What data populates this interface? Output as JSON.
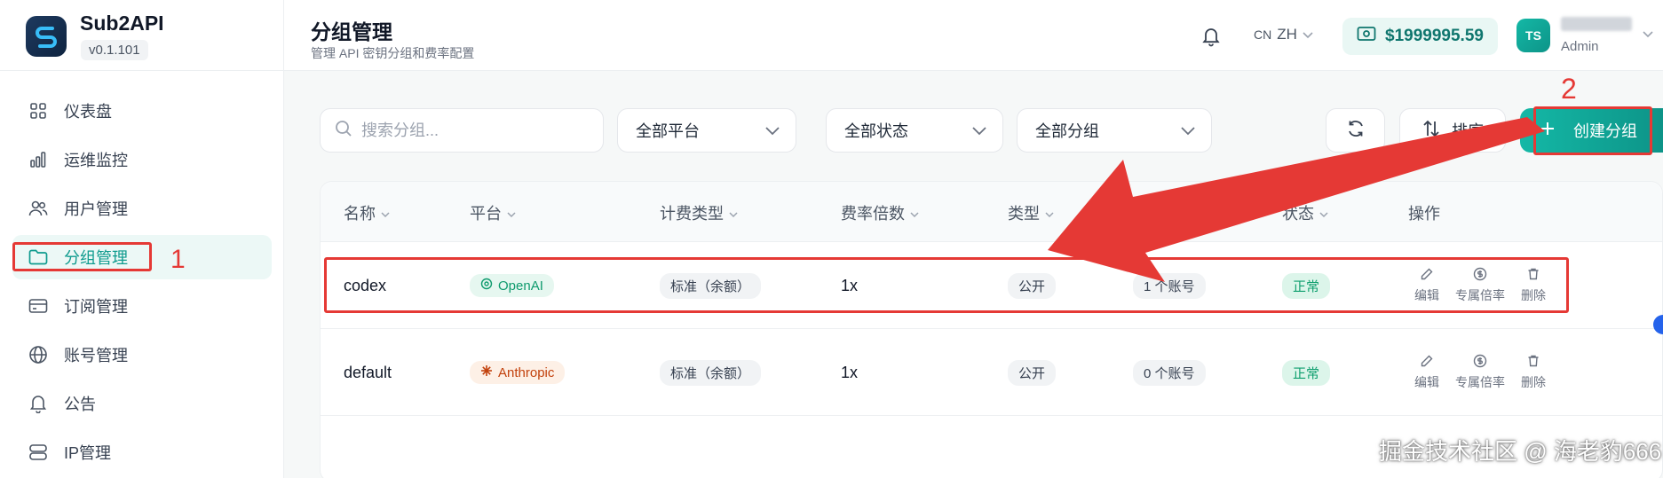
{
  "app": {
    "name": "Sub2API",
    "version": "v0.1.101"
  },
  "sidebar": {
    "items": [
      {
        "label": "仪表盘",
        "icon": "grid-icon"
      },
      {
        "label": "运维监控",
        "icon": "bar-chart-icon"
      },
      {
        "label": "用户管理",
        "icon": "users-icon"
      },
      {
        "label": "分组管理",
        "icon": "folder-icon",
        "active": true
      },
      {
        "label": "订阅管理",
        "icon": "card-icon"
      },
      {
        "label": "账号管理",
        "icon": "globe-icon"
      },
      {
        "label": "公告",
        "icon": "bell-icon"
      },
      {
        "label": "IP管理",
        "icon": "server-icon"
      }
    ]
  },
  "header": {
    "title": "分组管理",
    "subtitle": "管理 API 密钥分组和费率配置",
    "lang_prefix": "CN",
    "lang": "ZH",
    "balance": "$1999995.59",
    "avatar_text": "TS",
    "user_role": "Admin"
  },
  "toolbar": {
    "search_placeholder": "搜索分组...",
    "platform_select": "全部平台",
    "status_select": "全部状态",
    "group_select": "全部分组",
    "sort_label": "排序",
    "create_label": "创建分组"
  },
  "table": {
    "headers": [
      "名称",
      "平台",
      "计费类型",
      "费率倍数",
      "类型",
      "状态",
      "操作"
    ],
    "rows": [
      {
        "name": "codex",
        "platform": "OpenAI",
        "billing": "标准（余额）",
        "rate": "1x",
        "type": "公开",
        "accounts": "1 个账号",
        "status": "正常"
      },
      {
        "name": "default",
        "platform": "Anthropic",
        "billing": "标准（余额）",
        "rate": "1x",
        "type": "公开",
        "accounts": "0 个账号",
        "status": "正常"
      }
    ],
    "actions": [
      "编辑",
      "专属倍率",
      "删除"
    ]
  },
  "annotations": {
    "marker_1": "1",
    "marker_2": "2",
    "accent": "#e53935"
  },
  "watermark": "掘金技术社区 @ 海老豹666"
}
